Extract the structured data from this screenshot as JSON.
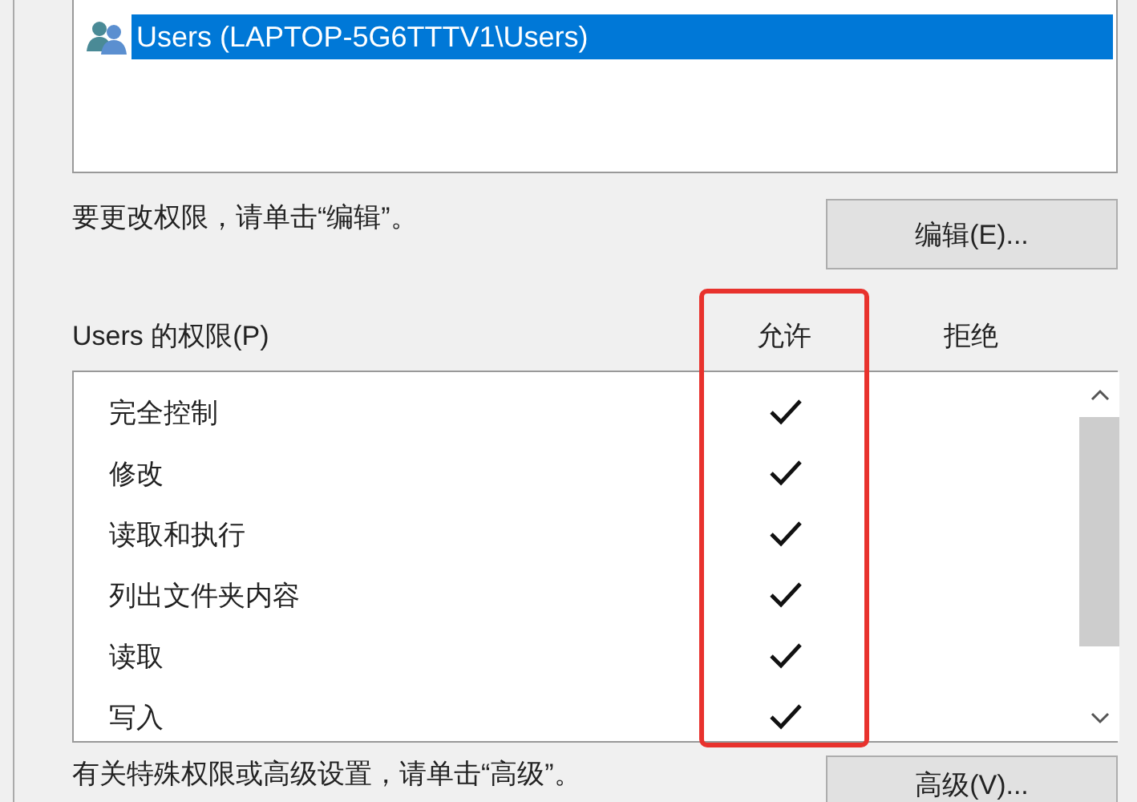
{
  "principals": [
    {
      "name": "Users (LAPTOP-5G6TTTV1\\Users)",
      "selected": true
    }
  ],
  "edit_hint": "要更改权限，请单击“编辑”。",
  "edit_button": "编辑(E)...",
  "permissions": {
    "title": "Users 的权限(P)",
    "columns": [
      "允许",
      "拒绝"
    ],
    "rows": [
      {
        "name": "完全控制",
        "allow": true,
        "deny": false
      },
      {
        "name": "修改",
        "allow": true,
        "deny": false
      },
      {
        "name": "读取和执行",
        "allow": true,
        "deny": false
      },
      {
        "name": "列出文件夹内容",
        "allow": true,
        "deny": false
      },
      {
        "name": "读取",
        "allow": true,
        "deny": false
      },
      {
        "name": "写入",
        "allow": true,
        "deny": false
      }
    ]
  },
  "advanced_hint": "有关特殊权限或高级设置，请单击“高级”。",
  "advanced_button": "高级(V)..."
}
